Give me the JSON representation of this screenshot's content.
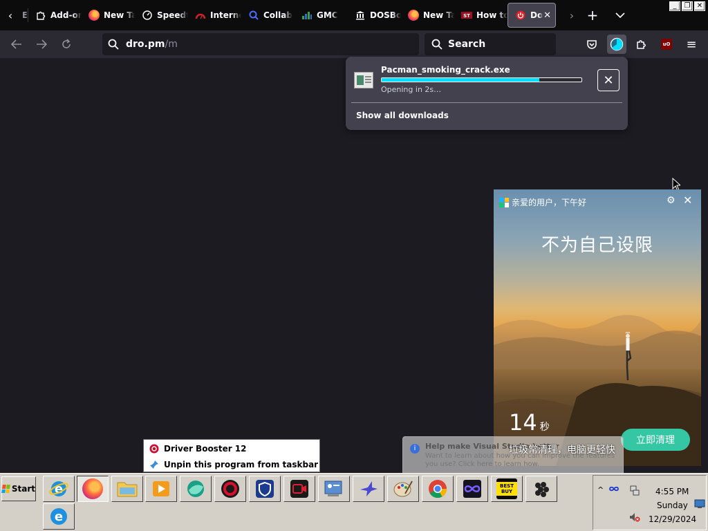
{
  "browser": {
    "tabs": [
      {
        "label": "E",
        "icon": "extension-icon"
      },
      {
        "label": "Add-ons",
        "icon": "puzzle-icon"
      },
      {
        "label": "New Tab",
        "icon": "firefox-icon"
      },
      {
        "label": "Speedtest",
        "icon": "speedometer-icon"
      },
      {
        "label": "Internet",
        "icon": "gauge-icon"
      },
      {
        "label": "Collab",
        "icon": "search-icon"
      },
      {
        "label": "GMC",
        "icon": "chart-icon"
      },
      {
        "label": "DOSBox",
        "icon": "building-icon"
      },
      {
        "label": "New Tab",
        "icon": "firefox-icon"
      },
      {
        "label": "How to",
        "icon": "site-icon"
      },
      {
        "label": "Do",
        "icon": "power-icon",
        "active": true
      }
    ],
    "url": {
      "domain": "dro.pm",
      "path": "/m"
    },
    "search_placeholder": "Search",
    "toolbar": {
      "new_tab": "+",
      "tab_list": "⌄",
      "menu": "≡"
    }
  },
  "downloads_panel": {
    "filename": "Pacman_smoking_crack.exe",
    "progress": 0.79,
    "status": "Opening in 2s…",
    "show_all": "Show all downloads"
  },
  "ad_popup": {
    "greeting": "亲爱的用户，下午好",
    "slogan": "不为自己设限",
    "countdown": "14",
    "countdown_unit": "秒",
    "clean_button": "立即清理",
    "banner_text": "垃圾常清理，电脑更轻快"
  },
  "notification": {
    "title": "Help make Visual Studio better",
    "body": "Want to learn about how you can improve the features you use? Click here to learn how."
  },
  "jump_list": {
    "items": [
      {
        "label": "Driver Booster 12",
        "icon": "driver-booster-icon"
      },
      {
        "label": "Unpin this program from taskbar",
        "icon": "unpin-icon"
      }
    ]
  },
  "taskbar": {
    "start_label": "Start",
    "apps": [
      "internet-explorer-icon",
      "firefox-icon",
      "file-explorer-icon",
      "media-player-icon",
      "browser-globe-icon",
      "driver-booster-icon",
      "vpn-shield-icon",
      "screen-recorder-icon",
      "control-panel-icon",
      "bird-app-icon",
      "paint-icon",
      "chrome-icon",
      "infinity-app-icon",
      "best-buy-icon",
      "blackberry-icon",
      "internet-explorer-icon"
    ],
    "best_buy_label": "BEST BUY",
    "clock": {
      "time": "4:55 PM",
      "day": "Sunday",
      "date": "12/29/2024"
    }
  },
  "colors": {
    "page_bg": "#1c1b22",
    "panel_bg": "#42414d",
    "progress": "#00ddff",
    "ad_button": "#35c7a3",
    "taskbar": "#d4d0c8"
  }
}
